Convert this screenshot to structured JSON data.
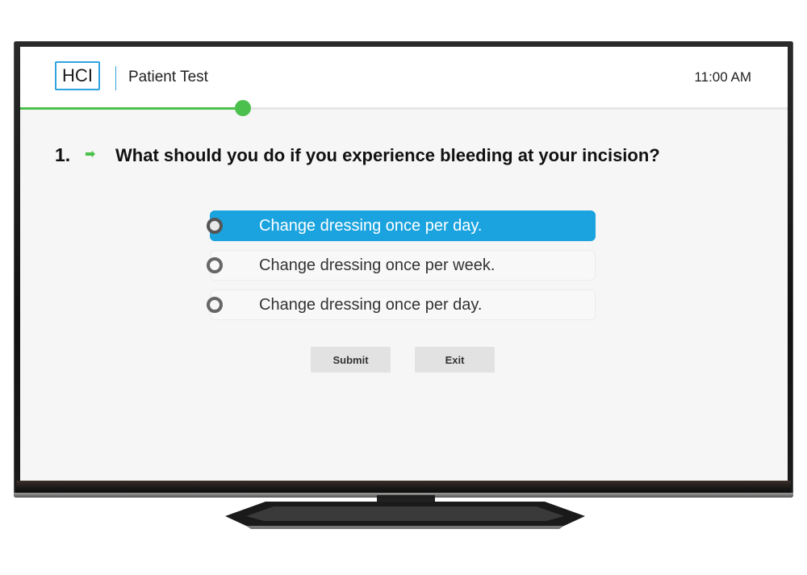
{
  "header": {
    "logo_text": "HCI",
    "title": "Patient Test",
    "time": "11:00 AM"
  },
  "progress": {
    "fraction": 0.29
  },
  "question": {
    "number": "1.",
    "arrow": "➡",
    "text": "What should you do if you experience bleeding at your incision?"
  },
  "options": [
    {
      "label": "Change dressing once per day.",
      "selected": true
    },
    {
      "label": "Change dressing once per week.",
      "selected": false
    },
    {
      "label": "Change dressing once per day.",
      "selected": false
    }
  ],
  "buttons": {
    "submit_label": "Submit",
    "exit_label": "Exit"
  },
  "colors": {
    "accent_blue": "#1aa3df",
    "progress_green": "#4cc04c",
    "logo_border": "#2ea3de"
  },
  "icons": {
    "progress_marker": "arrow-right-icon",
    "option_marker": "radio-icon"
  }
}
